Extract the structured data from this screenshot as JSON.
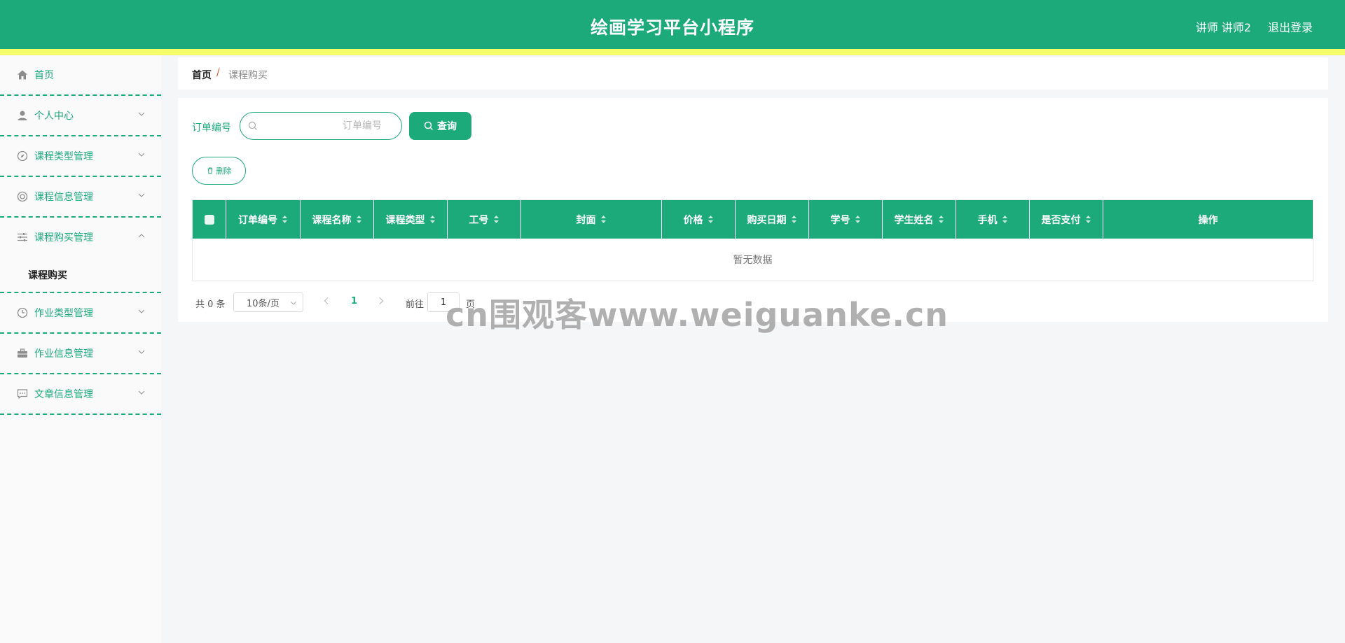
{
  "header": {
    "title": "绘画学习平台小程序",
    "user": "讲师 讲师2",
    "logout": "退出登录"
  },
  "sidebar": {
    "items": [
      {
        "label": "首页",
        "icon": "home-icon"
      },
      {
        "label": "个人中心",
        "icon": "user-icon"
      },
      {
        "label": "课程类型管理",
        "icon": "compass-icon"
      },
      {
        "label": "课程信息管理",
        "icon": "lifebuoy-icon"
      },
      {
        "label": "课程购买管理",
        "icon": "sliders-icon",
        "open": true,
        "children": [
          "课程购买"
        ]
      },
      {
        "label": "作业类型管理",
        "icon": "clock-icon"
      },
      {
        "label": "作业信息管理",
        "icon": "briefcase-icon"
      },
      {
        "label": "文章信息管理",
        "icon": "chat-icon"
      }
    ]
  },
  "breadcrumb": {
    "home": "首页",
    "separator": "/",
    "current": "课程购买"
  },
  "search": {
    "label": "订单编号",
    "placeholder": "订单编号",
    "button": "查询"
  },
  "actions": {
    "delete": "删除"
  },
  "table": {
    "columns": [
      "订单编号",
      "课程名称",
      "课程类型",
      "工号",
      "封面",
      "价格",
      "购买日期",
      "学号",
      "学生姓名",
      "手机",
      "是否支付",
      "操作"
    ],
    "empty": "暂无数据"
  },
  "pagination": {
    "total": "共 0 条",
    "page_size": "10条/页",
    "current_page": "1",
    "goto_label": "前往",
    "goto_value": "1",
    "page_unit": "页"
  },
  "watermark": "cn围观客www.weiguanke.cn",
  "colors": {
    "primary": "#1daa7b",
    "accent_strip": "#f6fd6b"
  }
}
